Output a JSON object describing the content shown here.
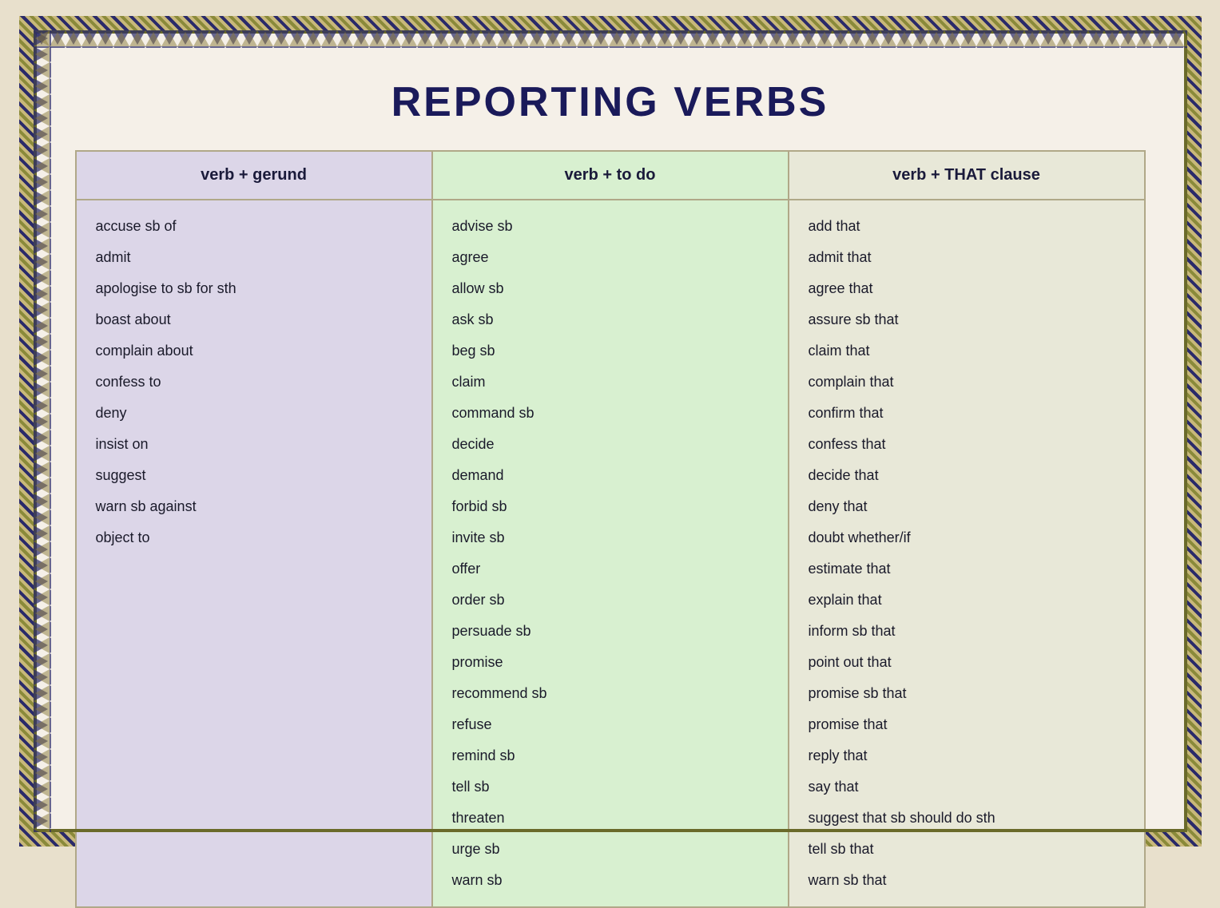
{
  "page": {
    "title": "REPORTING VERBS",
    "background_color": "#e8e0cc"
  },
  "columns": [
    {
      "id": "col-gerund",
      "header": "verb + gerund",
      "items": [
        "accuse sb of",
        "admit",
        "apologise to sb for sth",
        "boast about",
        "complain about",
        "confess to",
        "deny",
        "insist on",
        "suggest",
        "warn sb against",
        "object to"
      ]
    },
    {
      "id": "col-todo",
      "header": "verb + to do",
      "items": [
        "advise sb",
        "agree",
        "allow sb",
        "ask sb",
        "beg sb",
        "claim",
        "command sb",
        "decide",
        "demand",
        "forbid sb",
        "invite sb",
        "offer",
        "order sb",
        "persuade sb",
        "promise",
        "recommend sb",
        "refuse",
        "remind sb",
        "tell sb",
        "threaten",
        "urge sb",
        "warn sb"
      ]
    },
    {
      "id": "col-that",
      "header": "verb + THAT clause",
      "items": [
        "add that",
        "admit that",
        "agree that",
        "assure sb that",
        "claim that",
        "complain that",
        "confirm that",
        "confess that",
        "decide that",
        "deny that",
        "doubt whether/if",
        "estimate that",
        "explain that",
        "inform sb that",
        "point out that",
        "promise sb that",
        "promise that",
        "reply that",
        "say that",
        "suggest that sb should do sth",
        "tell sb that",
        "warn sb that"
      ]
    }
  ]
}
